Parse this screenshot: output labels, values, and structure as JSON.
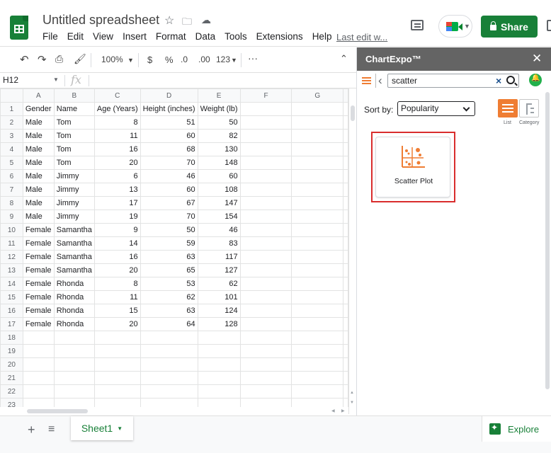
{
  "header": {
    "doc_title": "Untitled spreadsheet",
    "menu": [
      "File",
      "Edit",
      "View",
      "Insert",
      "Format",
      "Data",
      "Tools",
      "Extensions",
      "Help"
    ],
    "last_edit": "Last edit w...",
    "share_label": "Share"
  },
  "toolbar": {
    "zoom": "100%",
    "currency": "$",
    "percent": "%",
    "dec_decrease": ".0",
    "dec_increase": ".00",
    "format_more": "123"
  },
  "formula_bar": {
    "name_box": "H12",
    "fx": "fx"
  },
  "sheet": {
    "columns": [
      "A",
      "B",
      "C",
      "D",
      "E",
      "F",
      "G"
    ],
    "rows": [
      {
        "n": "1",
        "cells": [
          "Gender",
          "Name",
          "Age (Years)",
          "Height (inches)",
          "Weight (lb)"
        ]
      },
      {
        "n": "2",
        "cells": [
          "Male",
          "Tom",
          "8",
          "51",
          "50"
        ]
      },
      {
        "n": "3",
        "cells": [
          "Male",
          "Tom",
          "11",
          "60",
          "82"
        ]
      },
      {
        "n": "4",
        "cells": [
          "Male",
          "Tom",
          "16",
          "68",
          "130"
        ]
      },
      {
        "n": "5",
        "cells": [
          "Male",
          "Tom",
          "20",
          "70",
          "148"
        ]
      },
      {
        "n": "6",
        "cells": [
          "Male",
          "Jimmy",
          "6",
          "46",
          "60"
        ]
      },
      {
        "n": "7",
        "cells": [
          "Male",
          "Jimmy",
          "13",
          "60",
          "108"
        ]
      },
      {
        "n": "8",
        "cells": [
          "Male",
          "Jimmy",
          "17",
          "67",
          "147"
        ]
      },
      {
        "n": "9",
        "cells": [
          "Male",
          "Jimmy",
          "19",
          "70",
          "154"
        ]
      },
      {
        "n": "10",
        "cells": [
          "Female",
          "Samantha",
          "9",
          "50",
          "46"
        ]
      },
      {
        "n": "11",
        "cells": [
          "Female",
          "Samantha",
          "14",
          "59",
          "83"
        ]
      },
      {
        "n": "12",
        "cells": [
          "Female",
          "Samantha",
          "16",
          "63",
          "117"
        ]
      },
      {
        "n": "13",
        "cells": [
          "Female",
          "Samantha",
          "20",
          "65",
          "127"
        ]
      },
      {
        "n": "14",
        "cells": [
          "Female",
          "Rhonda",
          "8",
          "53",
          "62"
        ]
      },
      {
        "n": "15",
        "cells": [
          "Female",
          "Rhonda",
          "11",
          "62",
          "101"
        ]
      },
      {
        "n": "16",
        "cells": [
          "Female",
          "Rhonda",
          "15",
          "63",
          "124"
        ]
      },
      {
        "n": "17",
        "cells": [
          "Female",
          "Rhonda",
          "20",
          "64",
          "128"
        ]
      },
      {
        "n": "18",
        "cells": []
      },
      {
        "n": "19",
        "cells": []
      },
      {
        "n": "20",
        "cells": []
      },
      {
        "n": "21",
        "cells": []
      },
      {
        "n": "22",
        "cells": []
      },
      {
        "n": "23",
        "cells": []
      }
    ]
  },
  "bottom": {
    "sheet_tab": "Sheet1",
    "explore": "Explore"
  },
  "panel": {
    "title": "ChartExpo™",
    "search_value": "scatter",
    "sort_label": "Sort by:",
    "sort_value": "Popularity",
    "view_list_label": "List",
    "view_category_label": "Category",
    "result_label": "Scatter Plot",
    "accent_color": "#ef7d33",
    "highlight_color": "#d92d2d"
  }
}
